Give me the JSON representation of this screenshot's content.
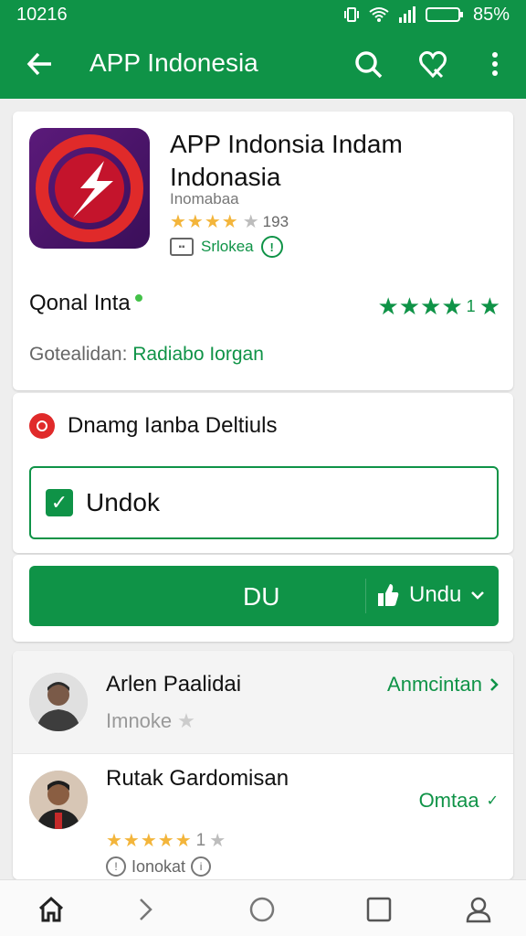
{
  "status_bar": {
    "time": "10216",
    "battery_text": "85%"
  },
  "toolbar": {
    "title": "APP Indonesia"
  },
  "app": {
    "name": "APP Indonsia Indam Indonasia",
    "developer": "Inomabaa",
    "rating_count": "193",
    "install_status": "Srlokea"
  },
  "summary": {
    "title": "Qonal Inta",
    "stars_count": "1",
    "category_label": "Gotealidan:",
    "category_value": "Radiabo Iorgan"
  },
  "details": {
    "title": "Dnamg Ianba Deltiuls",
    "checkbox_label": "Undok"
  },
  "action": {
    "primary_label": "DU",
    "secondary_label": "Undu"
  },
  "reviews": [
    {
      "name": "Arlen Paalidai",
      "subtitle": "Imnoke",
      "link": "Anmcintan"
    },
    {
      "name": "Rutak Gardomisan",
      "stars_count": "1",
      "footer": "Ionokat",
      "link": "Omtaa"
    }
  ],
  "colors": {
    "primary": "#0f9347",
    "star_gold": "#f3b53b",
    "accent_red": "#e02a2a"
  }
}
